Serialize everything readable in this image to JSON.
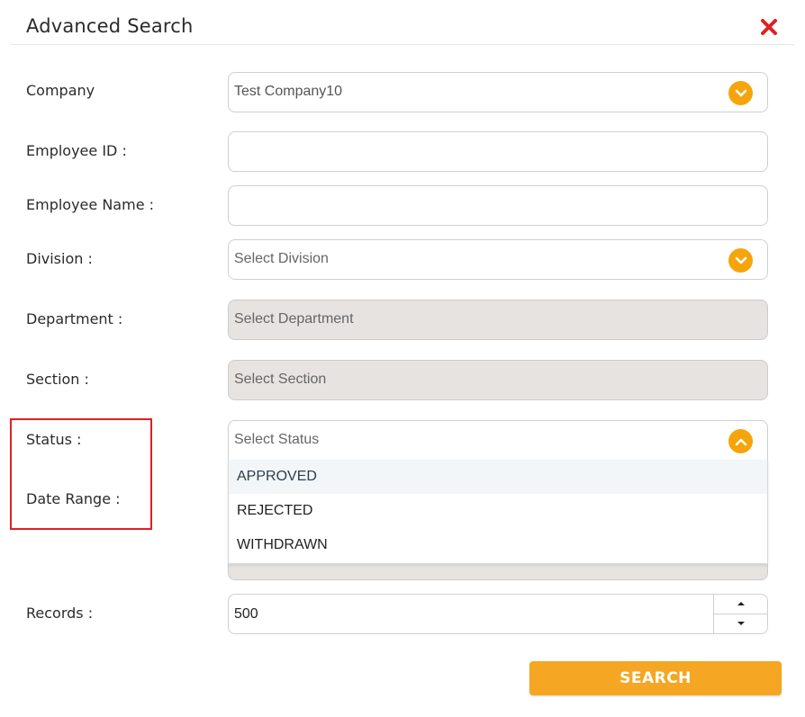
{
  "dialog": {
    "title": "Advanced Search",
    "close_icon": "close-x-icon"
  },
  "fields": {
    "company": {
      "label": "Company",
      "value": "Test Company10"
    },
    "employee_id": {
      "label": "Employee ID :",
      "value": ""
    },
    "employee_name": {
      "label": "Employee Name :",
      "value": ""
    },
    "division": {
      "label": "Division :",
      "placeholder": "Select Division"
    },
    "department": {
      "label": "Department :",
      "placeholder": "Select Department"
    },
    "section": {
      "label": "Section :",
      "placeholder": "Select Section"
    },
    "status": {
      "label": "Status :",
      "placeholder": "Select Status",
      "options": [
        "APPROVED",
        "REJECTED",
        "WITHDRAWN"
      ]
    },
    "date_range": {
      "label": "Date Range :"
    },
    "records": {
      "label": "Records :",
      "value": "500"
    }
  },
  "actions": {
    "search_label": "SEARCH"
  },
  "colors": {
    "accent": "#f5a623",
    "chevron": "#f5a40c",
    "close": "#e02020",
    "highlight": "#e02020",
    "disabled_bg": "#e6e3e1"
  }
}
